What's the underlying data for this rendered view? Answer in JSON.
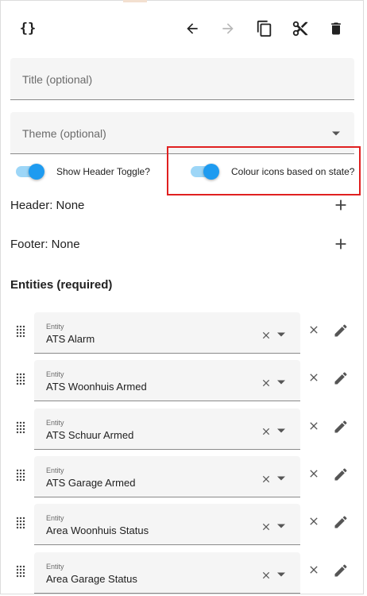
{
  "toolbar": {
    "icons": [
      "code-braces-icon",
      "arrow-left-icon",
      "arrow-right-icon",
      "copy-icon",
      "cut-icon",
      "delete-icon"
    ]
  },
  "title_field": {
    "placeholder": "Title (optional)"
  },
  "theme_field": {
    "placeholder": "Theme (optional)"
  },
  "toggles": {
    "show_header": {
      "label": "Show Header Toggle?",
      "checked": true
    },
    "colour_icons": {
      "label": "Colour icons based on state?",
      "checked": true
    }
  },
  "header_row": {
    "label": "Header: None"
  },
  "footer_row": {
    "label": "Footer: None"
  },
  "entities": {
    "title": "Entities (required)",
    "field_label": "Entity",
    "items": [
      {
        "value": "ATS Alarm"
      },
      {
        "value": "ATS Woonhuis Armed"
      },
      {
        "value": "ATS Schuur Armed"
      },
      {
        "value": "ATS Garage Armed"
      },
      {
        "value": "Area Woonhuis Status"
      },
      {
        "value": "Area Garage Status"
      }
    ]
  },
  "colors": {
    "accent": "#1e9bf0",
    "accent_light": "#9dd6f7",
    "highlight_border": "#e02020",
    "field_bg": "#f5f5f5"
  }
}
